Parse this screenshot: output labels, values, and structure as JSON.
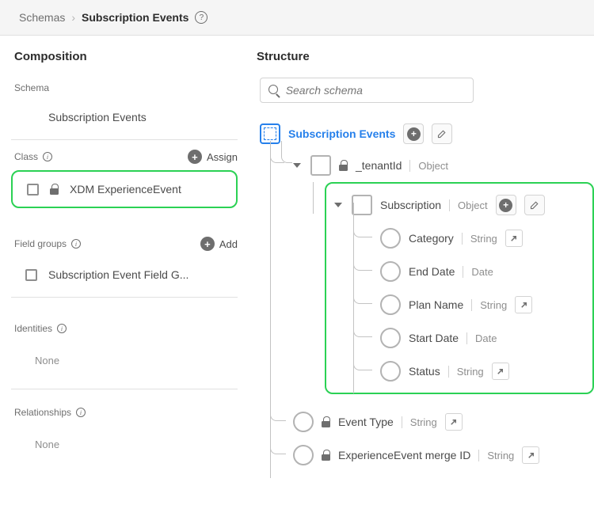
{
  "breadcrumb": {
    "parent": "Schemas",
    "current": "Subscription Events"
  },
  "composition": {
    "title": "Composition",
    "schema_label": "Schema",
    "schema_name": "Subscription Events",
    "class_label": "Class",
    "assign_label": "Assign",
    "class_name": "XDM ExperienceEvent",
    "field_groups_label": "Field groups",
    "add_label": "Add",
    "field_group_name": "Subscription Event Field G...",
    "identities_label": "Identities",
    "relationships_label": "Relationships",
    "none": "None"
  },
  "structure": {
    "title": "Structure",
    "search_placeholder": "Search schema",
    "root": "Subscription Events",
    "tenant": {
      "name": "_tenantId",
      "type": "Object"
    },
    "subscription": {
      "name": "Subscription",
      "type": "Object",
      "fields": [
        {
          "name": "Category",
          "type": "String",
          "link": true
        },
        {
          "name": "End Date",
          "type": "Date",
          "link": false
        },
        {
          "name": "Plan Name",
          "type": "String",
          "link": true
        },
        {
          "name": "Start Date",
          "type": "Date",
          "link": false
        },
        {
          "name": "Status",
          "type": "String",
          "link": true
        }
      ]
    },
    "siblings": [
      {
        "name": "Event Type",
        "type": "String",
        "link": true,
        "locked": true
      },
      {
        "name": "ExperienceEvent merge ID",
        "type": "String",
        "link": true,
        "locked": true
      }
    ]
  }
}
